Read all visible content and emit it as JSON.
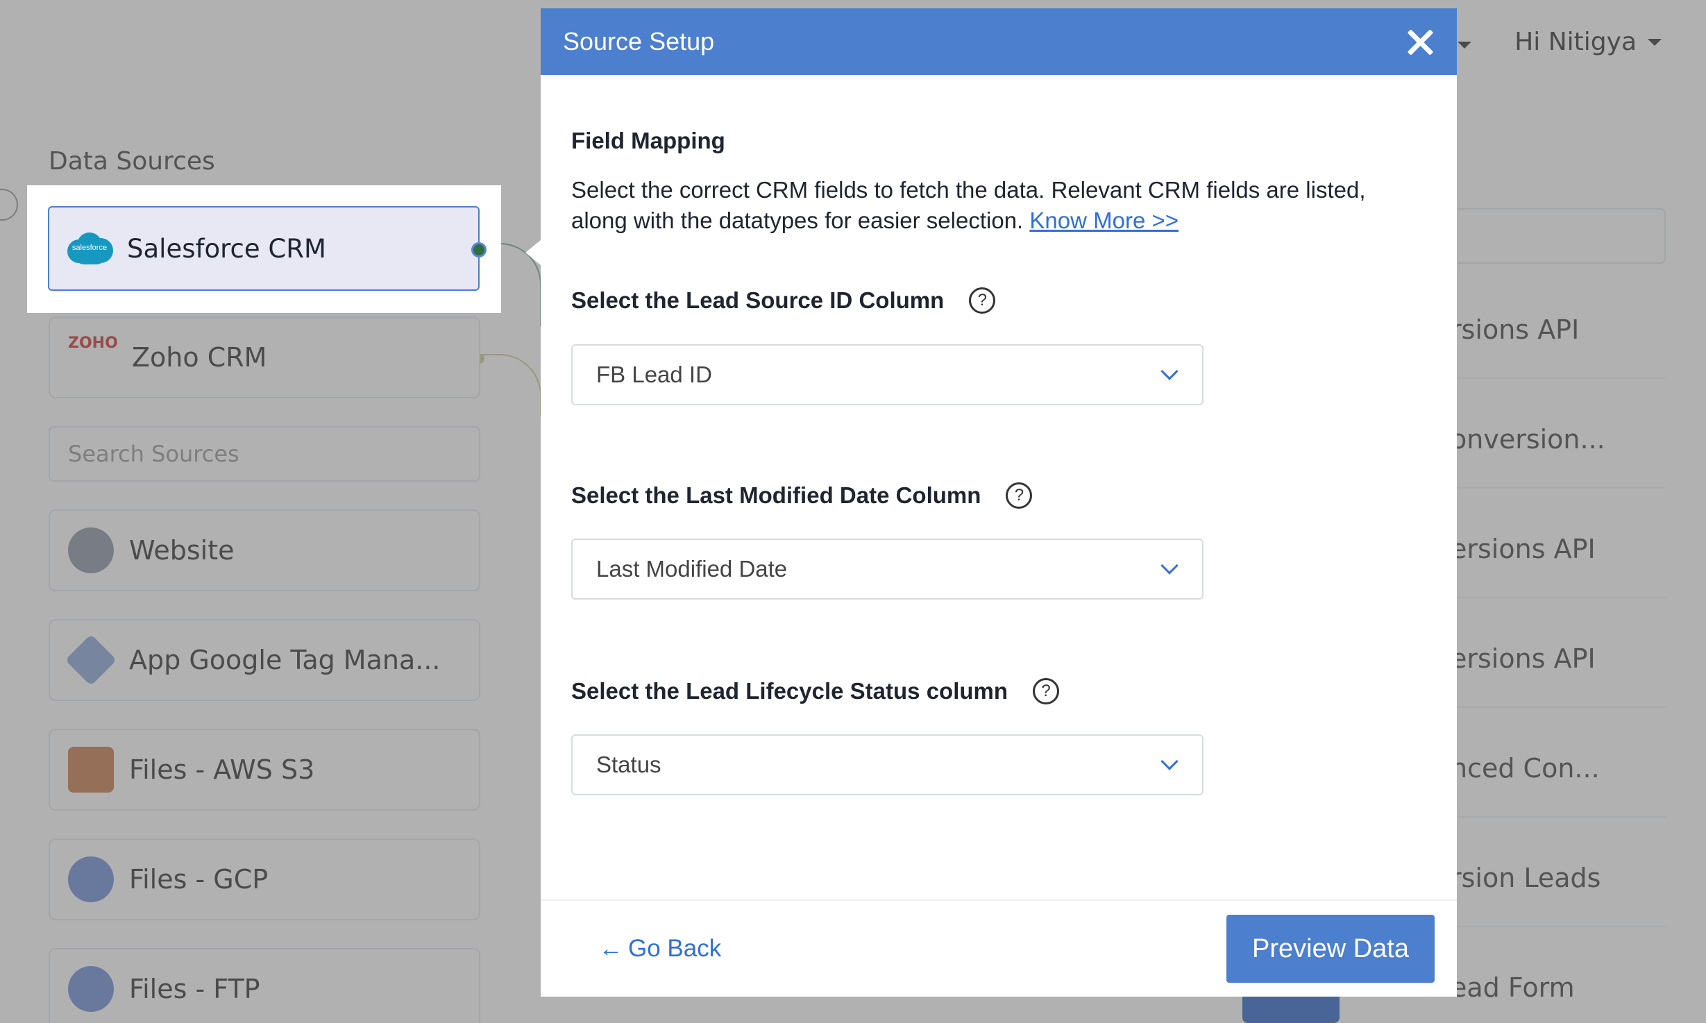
{
  "background": {
    "user_greeting": "Hi Nitigya",
    "data_sources_title": "Data Sources",
    "sources": [
      {
        "label": "Zoho CRM",
        "icon": "zoho-icon"
      },
      {
        "label": "Website",
        "icon": "globe-icon"
      },
      {
        "label": "App Google Tag Mana...",
        "icon": "gtm-icon"
      },
      {
        "label": "Files - AWS S3",
        "icon": "aws-s3-icon"
      },
      {
        "label": "Files - GCP",
        "icon": "gcp-icon"
      },
      {
        "label": "Files - FTP",
        "icon": "folder-icon"
      }
    ],
    "search_placeholder": "Search Sources",
    "destinations": [
      "rsions API",
      "onversion...",
      "ersions API",
      "ersions API",
      "nced Con...",
      "rsion Leads",
      "ead Form"
    ]
  },
  "selected_source": {
    "label": "Salesforce CRM",
    "logo_text": "salesforce",
    "icon": "salesforce-icon"
  },
  "modal": {
    "title": "Source Setup",
    "section_title": "Field Mapping",
    "description": "Select the correct CRM fields to fetch the data. Relevant CRM fields are listed, along with the datatypes for easier selection.",
    "know_more": "Know More >>",
    "fields": [
      {
        "label": "Select the Lead Source ID Column",
        "value": "FB Lead ID"
      },
      {
        "label": "Select the Last Modified Date Column",
        "value": "Last Modified Date"
      },
      {
        "label": "Select the Lead Lifecycle Status column",
        "value": "Status"
      }
    ],
    "go_back": "Go Back",
    "preview": "Preview Data"
  },
  "colors": {
    "primary": "#4c7fcd",
    "link": "#2f6fd6",
    "selected_bg": "#e7e8f4"
  }
}
